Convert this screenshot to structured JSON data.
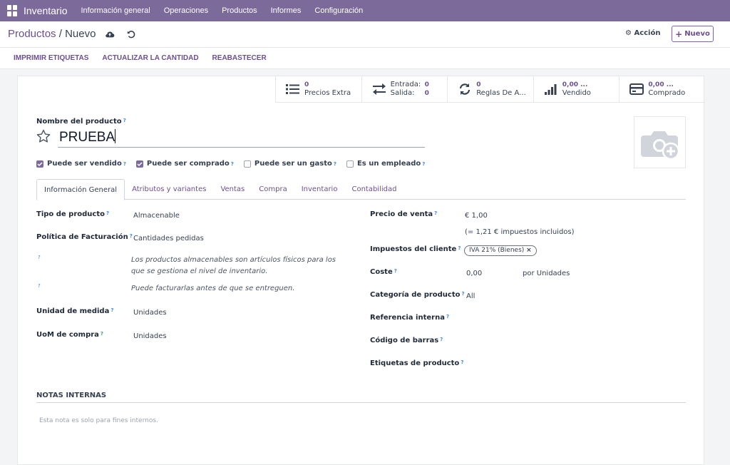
{
  "topbar": {
    "app_name": "Inventario",
    "menu": [
      "Información general",
      "Operaciones",
      "Productos",
      "Informes",
      "Configuración"
    ]
  },
  "breadcrumb": {
    "parent": "Productos",
    "separator": " / ",
    "current": "Nuevo"
  },
  "control": {
    "accion_label": "Acción",
    "nuevo_label": "Nuevo"
  },
  "actions": [
    "IMPRIMIR ETIQUETAS",
    "ACTUALIZAR LA CANTIDAD",
    "REABASTECER"
  ],
  "stats": {
    "precios_extra": {
      "value": "0",
      "label": "Precios Extra"
    },
    "entrada": {
      "label": "Entrada:",
      "value": "0"
    },
    "salida": {
      "label": "Salida:",
      "value": "0"
    },
    "reglas": {
      "value": "0",
      "label": "Reglas De A..."
    },
    "vendido": {
      "value": "0,00 ...",
      "label": "Vendido"
    },
    "comprado": {
      "value": "0,00 ...",
      "label": "Comprado"
    }
  },
  "product": {
    "name_label": "Nombre del producto",
    "name_value": "PRUEBA",
    "checkboxes": [
      {
        "label": "Puede ser vendido",
        "checked": true
      },
      {
        "label": "Puede ser comprado",
        "checked": true
      },
      {
        "label": "Puede ser un gasto",
        "checked": false
      },
      {
        "label": "Es un empleado",
        "checked": false
      }
    ]
  },
  "tabs": [
    "Información General",
    "Atributos y variantes",
    "Ventas",
    "Compra",
    "Inventario",
    "Contabilidad"
  ],
  "left_fields": {
    "tipo_label": "Tipo de producto",
    "tipo_value": "Almacenable",
    "politica_label": "Política de Facturación",
    "politica_value": "Cantidades pedidas",
    "help1": "Los productos almacenables son artículos físicos para los que se gestiona el nivel de inventario.",
    "help2": "Puede facturarlas antes de que se entreguen.",
    "uom_label": "Unidad de medida",
    "uom_value": "Unidades",
    "uom_compra_label": "UoM de compra",
    "uom_compra_value": "Unidades"
  },
  "right_fields": {
    "precio_label": "Precio de venta",
    "precio_value": "€ 1,00",
    "precio_note": "(= 1,21 € impuestos incluidos)",
    "impuestos_label": "Impuestos del cliente",
    "impuestos_tag": "IVA 21% (Bienes)",
    "coste_label": "Coste",
    "coste_value": "0,00",
    "coste_unit": "por Unidades",
    "categoria_label": "Categoría de producto",
    "categoria_value": "All",
    "referencia_label": "Referencia interna",
    "barras_label": "Código de barras",
    "etiquetas_label": "Etiquetas de producto"
  },
  "notas": {
    "title": "NOTAS INTERNAS",
    "placeholder": "Esta nota es solo para fines internos."
  },
  "colors": {
    "brand": "#7c6a9a",
    "link": "#6b4f8f"
  }
}
